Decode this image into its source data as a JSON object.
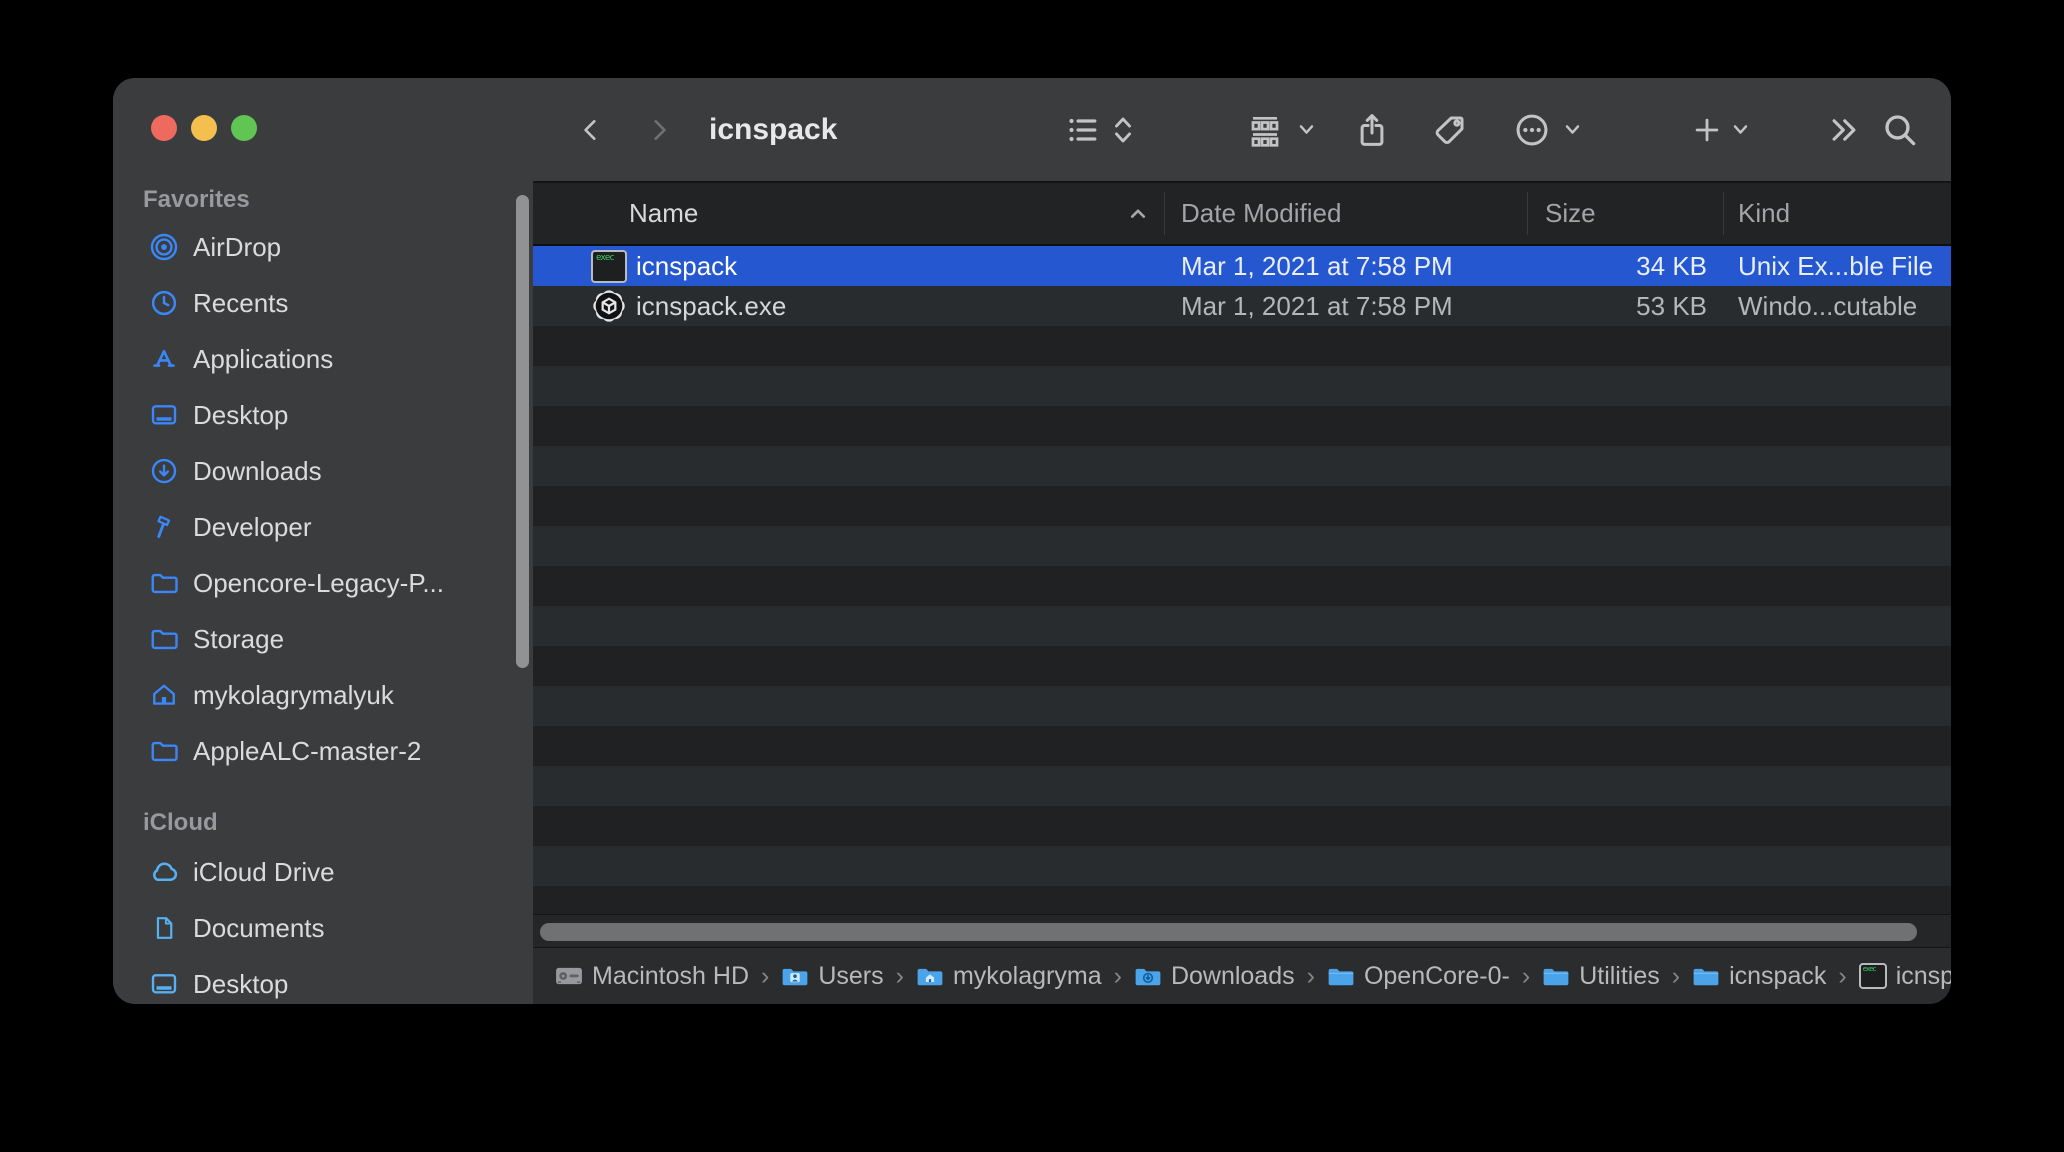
{
  "window": {
    "title": "icnspack"
  },
  "colors": {
    "selection_blue": "#2557d0",
    "sidebar_chrome": "#3a3c3e",
    "stripe_dark": "#1f2123",
    "stripe_light": "#292c2e",
    "favorites_icon_blue": "#3b87f7",
    "icloud_icon_blue": "#58b0f3",
    "traffic_red": "#ee6a5f",
    "traffic_yellow": "#f5bf4f",
    "traffic_green": "#61c554"
  },
  "sidebar": {
    "favorites": {
      "label": "Favorites",
      "items": [
        {
          "icon": "airdrop",
          "label": "AirDrop"
        },
        {
          "icon": "clock",
          "label": "Recents"
        },
        {
          "icon": "appstore",
          "label": "Applications"
        },
        {
          "icon": "desktop",
          "label": "Desktop"
        },
        {
          "icon": "download-circle",
          "label": "Downloads"
        },
        {
          "icon": "hammer",
          "label": "Developer"
        },
        {
          "icon": "folder",
          "label": "Opencore-Legacy-P..."
        },
        {
          "icon": "folder",
          "label": "Storage"
        },
        {
          "icon": "home",
          "label": "mykolagrymalyuk"
        },
        {
          "icon": "folder",
          "label": "AppleALC-master-2"
        }
      ]
    },
    "icloud": {
      "label": "iCloud",
      "items": [
        {
          "icon": "cloud",
          "label": "iCloud Drive"
        },
        {
          "icon": "document",
          "label": "Documents"
        },
        {
          "icon": "desktop",
          "label": "Desktop"
        }
      ]
    }
  },
  "toolbar": {
    "title": "icnspack"
  },
  "list": {
    "sort_column": "Name",
    "sort_direction": "ascending",
    "columns": [
      {
        "label": "Name"
      },
      {
        "label": "Date Modified"
      },
      {
        "label": "Size"
      },
      {
        "label": "Kind"
      }
    ],
    "rows": [
      {
        "icon": "exec",
        "name": "icnspack",
        "date": "Mar 1, 2021 at 7:58 PM",
        "size": "34 KB",
        "kind": "Unix Ex...ble File",
        "selected": true
      },
      {
        "icon": "exe-gear",
        "name": "icnspack.exe",
        "date": "Mar 1, 2021 at 7:58 PM",
        "size": "53 KB",
        "kind": "Windo...cutable",
        "selected": false
      }
    ]
  },
  "pathbar": {
    "separator": "›",
    "segments": [
      {
        "icon": "harddrive",
        "label": "Macintosh HD"
      },
      {
        "icon": "folder-users",
        "label": "Users"
      },
      {
        "icon": "folder-home",
        "label": "mykolagryma"
      },
      {
        "icon": "folder-download",
        "label": "Downloads"
      },
      {
        "icon": "folder-plain",
        "label": "OpenCore-0-"
      },
      {
        "icon": "folder-plain",
        "label": "Utilities"
      },
      {
        "icon": "folder-plain",
        "label": "icnspack"
      },
      {
        "icon": "exec-small",
        "label": "icnspack"
      }
    ]
  }
}
